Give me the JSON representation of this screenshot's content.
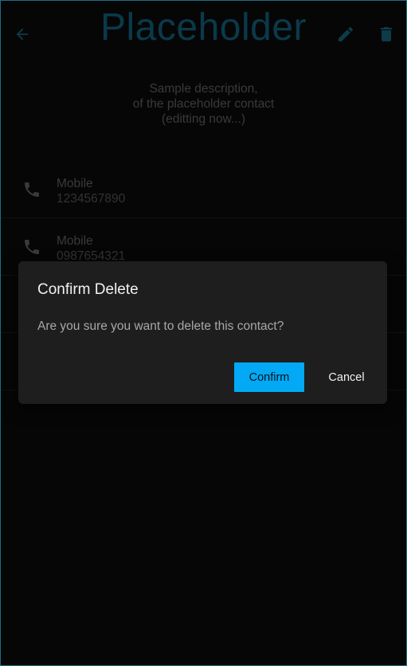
{
  "header": {
    "title": "Placeholder",
    "back_icon": "arrow-back-icon",
    "edit_icon": "pencil-icon",
    "delete_icon": "trash-icon"
  },
  "description": {
    "lines": [
      "Sample description,",
      "of the placeholder contact",
      "(editting now...)"
    ]
  },
  "contacts": [
    {
      "type": "Mobile",
      "number": "1234567890",
      "icon": "phone-icon"
    },
    {
      "type": "Mobile",
      "number": "0987654321",
      "icon": "phone-icon"
    }
  ],
  "dialog": {
    "title": "Confirm Delete",
    "message": "Are you sure you want to delete this contact?",
    "confirm_label": "Confirm",
    "cancel_label": "Cancel"
  },
  "colors": {
    "accent": "#03a9f4",
    "title_dim": "#0a3a4a",
    "dialog_bg": "#1e1e1e"
  }
}
